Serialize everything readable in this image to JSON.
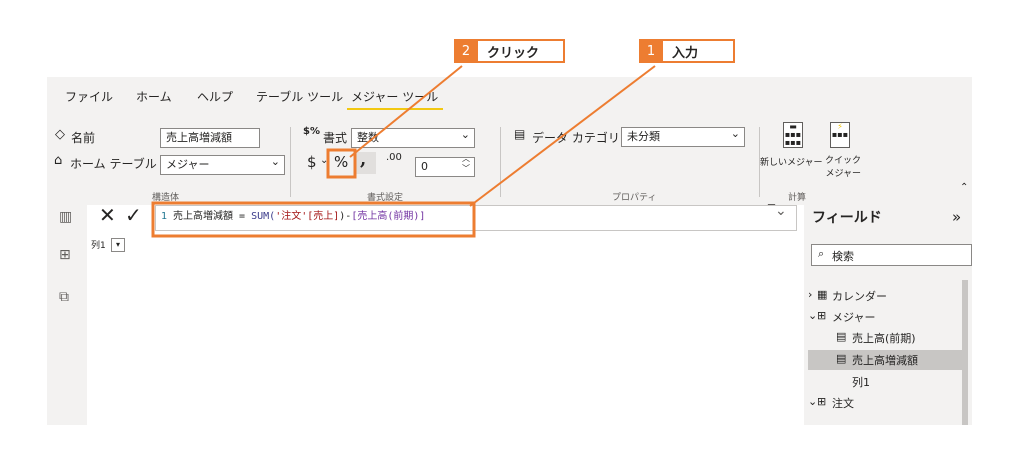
{
  "ribbon": {
    "tabs": [
      {
        "label": "ファイル",
        "active": false
      },
      {
        "label": "ホーム",
        "active": false
      },
      {
        "label": "ヘルプ",
        "active": false
      },
      {
        "label": "テーブル ツール",
        "active": false
      },
      {
        "label": "メジャー ツール",
        "active": true
      }
    ],
    "structure": {
      "name_label": "名前",
      "name_value": "売上高増減額",
      "home_table_label": "ホーム テーブル",
      "home_table_value": "メジャー",
      "group_label": "構造体"
    },
    "formatting": {
      "format_label": "書式",
      "format_value": "整数",
      "currency_symbol": "$",
      "percent_symbol": "%",
      "comma_symbol": ",",
      "decimal_symbol": ".00",
      "decimals_value": "0",
      "group_label": "書式設定"
    },
    "properties": {
      "data_category_label": "データ カテゴリ",
      "data_category_value": "未分類",
      "group_label": "プロパティ"
    },
    "calculations": {
      "new_measure_label": "新しいメジャー",
      "quick_measure_label": "クイック\nメジャー",
      "group_label": "計算"
    }
  },
  "formula_bar": {
    "line_number": "1",
    "measure_name": "売上高増減額",
    "operator": " = ",
    "function": "SUM(",
    "table_ref": "'注文'[売上]",
    "close_paren": ")-",
    "measure_ref": "[売上高(前期)]"
  },
  "column_header": {
    "label": "列1"
  },
  "fields_pane": {
    "title": "フィールド",
    "search_placeholder": "検索",
    "items": [
      {
        "label": "カレンダー",
        "indent": 0,
        "highlighted": false
      },
      {
        "label": "メジャー",
        "indent": 0,
        "highlighted": false
      },
      {
        "label": "売上高(前期)",
        "indent": 1,
        "highlighted": false
      },
      {
        "label": "売上高増減額",
        "indent": 1,
        "highlighted": true
      },
      {
        "label": "列1",
        "indent": 1,
        "highlighted": false
      },
      {
        "label": "注文",
        "indent": 0,
        "highlighted": false
      }
    ]
  },
  "callouts": [
    {
      "number": "2",
      "label": "クリック"
    },
    {
      "number": "1",
      "label": "入力"
    }
  ],
  "colors": {
    "annotation": "#ed7d31",
    "tab_underline": "#f2c811",
    "ribbon_bg": "#f3f2f1"
  }
}
